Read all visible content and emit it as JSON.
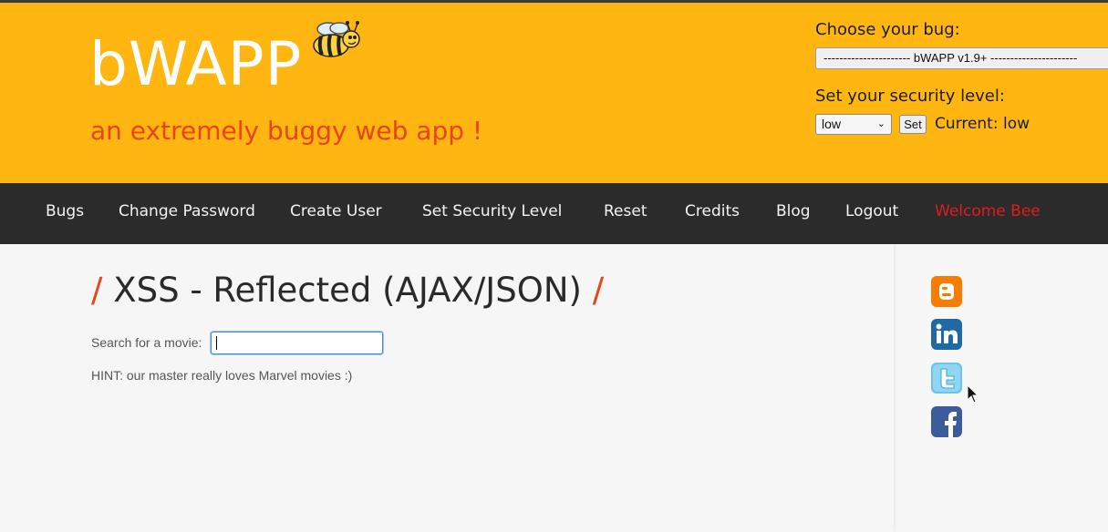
{
  "brand": {
    "logo": "bWAPP",
    "tagline": "an extremely buggy web app !"
  },
  "bug_chooser": {
    "label": "Choose your bug:",
    "selected": "---------------------- bWAPP v1.9+ ----------------------"
  },
  "security": {
    "label": "Set your security level:",
    "selected": "low",
    "set_label": "Set",
    "current_prefix": "Current: ",
    "current_value": "low"
  },
  "nav": {
    "items": [
      {
        "label": "Bugs"
      },
      {
        "label": "Change Password"
      },
      {
        "label": "Create User"
      },
      {
        "label": "Set Security Level"
      },
      {
        "label": "Reset"
      },
      {
        "label": "Credits"
      },
      {
        "label": "Blog"
      },
      {
        "label": "Logout"
      }
    ],
    "welcome": "Welcome Bee"
  },
  "main": {
    "title": "XSS - Reflected (AJAX/JSON)",
    "slash": "/",
    "search_label": "Search for a movie:",
    "search_value": "",
    "hint": "HINT: our master really loves Marvel movies :)"
  },
  "social": {
    "icons": [
      "blogger-icon",
      "linkedin-icon",
      "twitter-icon",
      "facebook-icon"
    ]
  },
  "colors": {
    "header": "#ffb610",
    "nav": "#2b2b2b",
    "accent": "#e8451d",
    "welcome": "#e01d1d"
  }
}
